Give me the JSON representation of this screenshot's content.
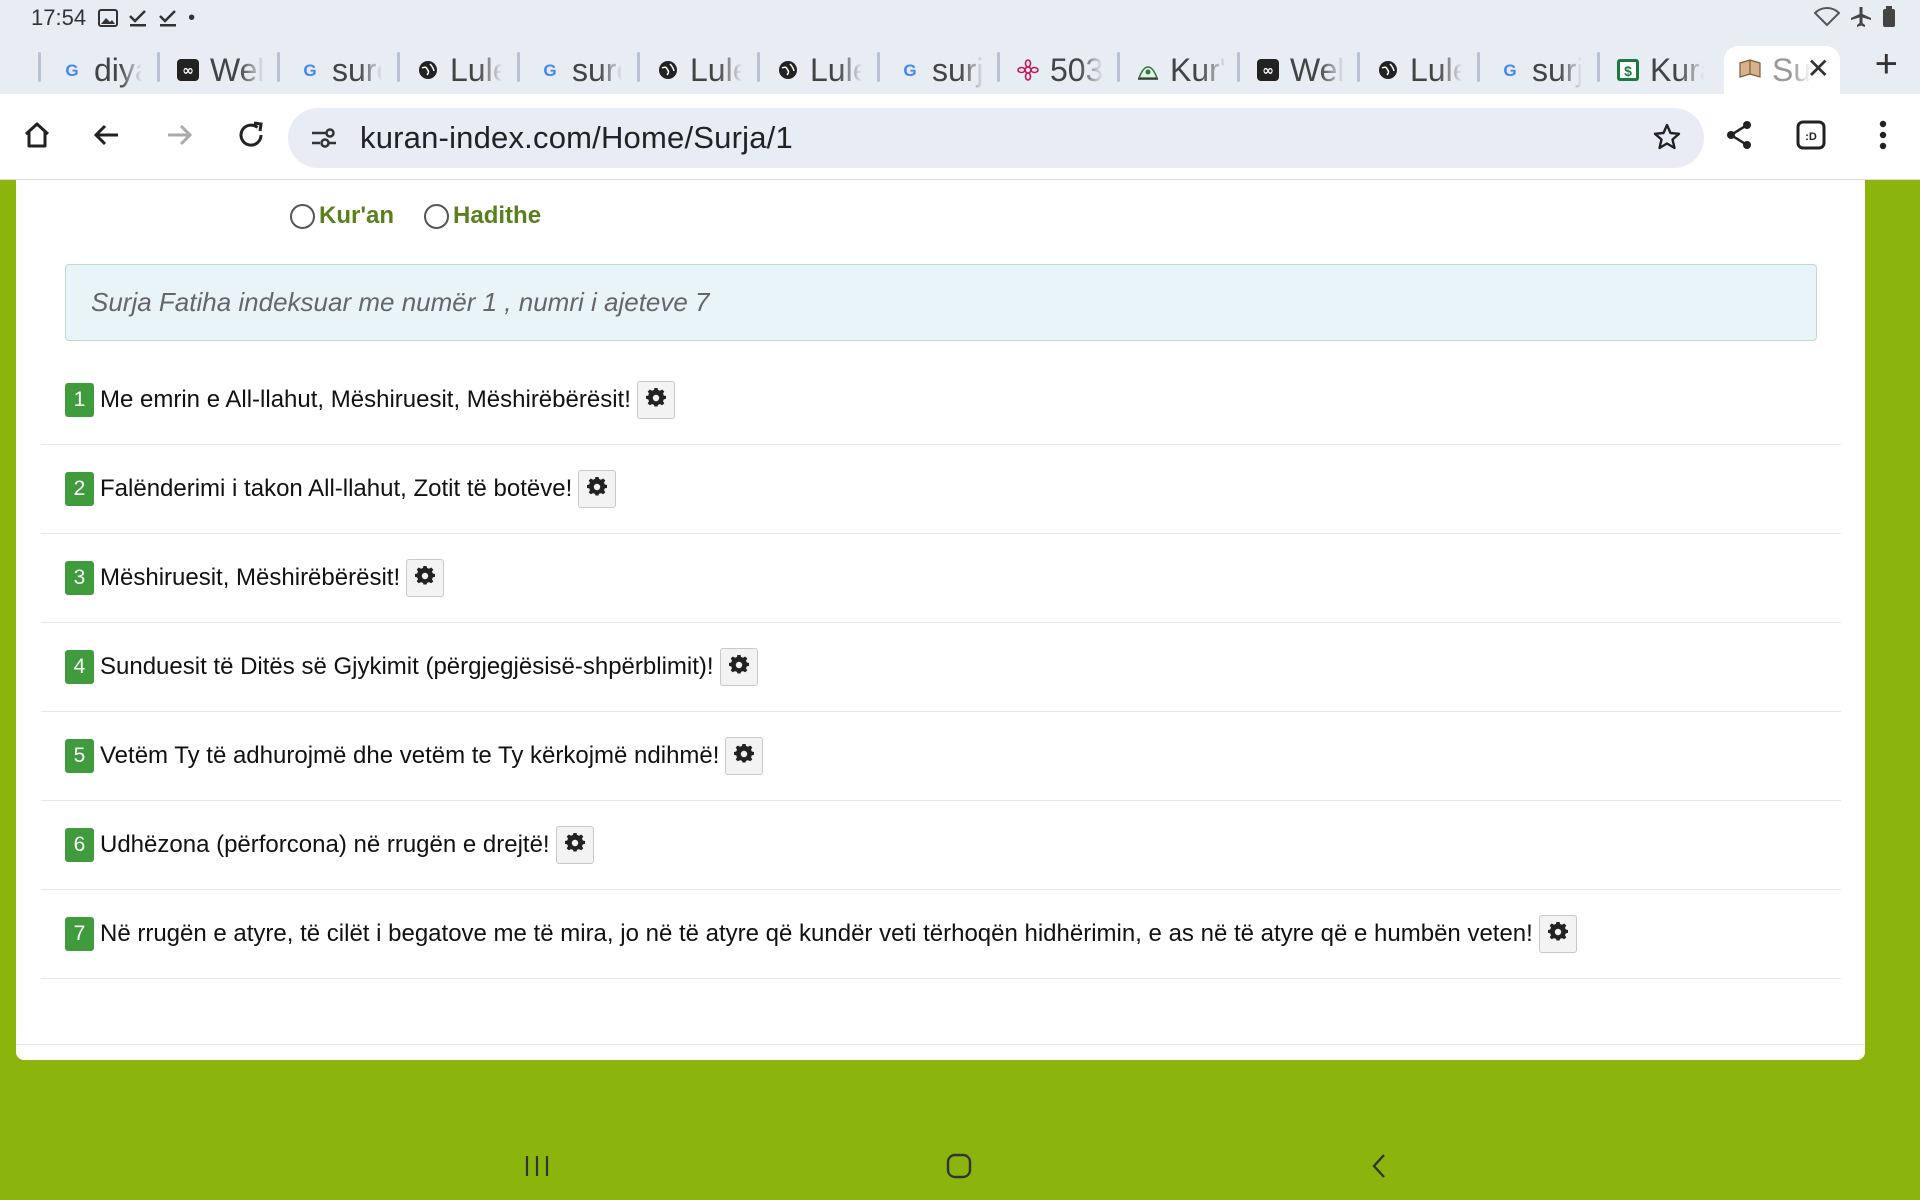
{
  "status_bar": {
    "time": "17:54"
  },
  "tabs": [
    {
      "icon": "google-icon",
      "title": "diya"
    },
    {
      "icon": "infinity-icon",
      "title": "Wel"
    },
    {
      "icon": "google-icon",
      "title": "sure"
    },
    {
      "icon": "globe-icon",
      "title": "Lule"
    },
    {
      "icon": "google-icon",
      "title": "sure"
    },
    {
      "icon": "globe-icon",
      "title": "Lule"
    },
    {
      "icon": "globe-icon",
      "title": "Lule"
    },
    {
      "icon": "google-icon",
      "title": "surj"
    },
    {
      "icon": "flower-icon",
      "title": "503"
    },
    {
      "icon": "mosque-icon",
      "title": "Kur'"
    },
    {
      "icon": "infinity-icon",
      "title": "Wel"
    },
    {
      "icon": "globe-icon",
      "title": "Lule"
    },
    {
      "icon": "google-icon",
      "title": "surj"
    },
    {
      "icon": "dollar-icon",
      "title": "Kura"
    },
    {
      "icon": "book-icon",
      "title": "Su",
      "active": true
    }
  ],
  "address_bar": {
    "url": "kuran-index.com/Home/Surja/1"
  },
  "search_options": {
    "kuran": "Kur'an",
    "hadithe": "Hadithe"
  },
  "info_text": "Surja Fatiha indeksuar me numër 1 , numri i ajeteve 7",
  "verses": [
    {
      "number": "1",
      "text": "Me emrin e All-llahut, Mëshiruesit, Mëshirëbërësit!"
    },
    {
      "number": "2",
      "text": "Falënderimi i takon All-llahut, Zotit të botëve!"
    },
    {
      "number": "3",
      "text": "Mëshiruesit, Mëshirëbërësit!"
    },
    {
      "number": "4",
      "text": "Sunduesit të Ditës së Gjykimit (përgjegjësisë-shpërblimit)!"
    },
    {
      "number": "5",
      "text": "Vetëm Ty të adhurojmë dhe vetëm te Ty kërkojmë ndihmë!"
    },
    {
      "number": "6",
      "text": "Udhëzona (përforcona) në rrugën e drejtë!"
    },
    {
      "number": "7",
      "text": "Në rrugën e atyre, të cilët i begatove me të mira, jo në të atyre që kundër veti tërhoqën hidhërimin, e as në të atyre që e humbën veten!"
    }
  ],
  "colors": {
    "page_background": "#8bb50d",
    "verse_badge": "#3f9b3b",
    "radio_label": "#5a7f1e",
    "info_background": "#e9f4f8"
  }
}
